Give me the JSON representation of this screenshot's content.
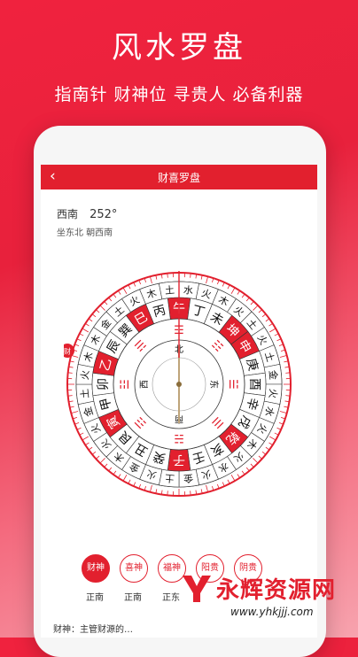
{
  "headline": "风水罗盘",
  "tagline": "指南针 财神位 寻贵人 必备利器",
  "appbar": {
    "back_label": "‹",
    "title": "财喜罗盘"
  },
  "direction": {
    "name": "西南",
    "degree": "252°",
    "detail": "坐东北 朝西南"
  },
  "compass": {
    "outer_ring_text": [
      "水",
      "火",
      "木",
      "火",
      "土",
      "火",
      "土",
      "金",
      "火",
      "水",
      "火",
      "木",
      "火",
      "水",
      "火",
      "金",
      "土",
      "火",
      "金",
      "木",
      "火",
      "火",
      "金",
      "土",
      "火",
      "木",
      "木",
      "金",
      "土",
      "火",
      "木",
      "土"
    ],
    "mountains": [
      "午",
      "丁",
      "未",
      "坤",
      "申",
      "庚",
      "酉",
      "辛",
      "戌",
      "乾",
      "亥",
      "壬",
      "子",
      "癸",
      "丑",
      "艮",
      "寅",
      "甲",
      "卯",
      "乙",
      "辰",
      "巽",
      "巳",
      "丙"
    ],
    "inner_labels": [
      "南",
      "西",
      "北",
      "东"
    ],
    "trigrams": [
      "☲",
      "☷",
      "☱",
      "☰",
      "☵",
      "☶",
      "☳",
      "☴"
    ],
    "side_mark": "财"
  },
  "markers": [
    {
      "label": "财神",
      "sub": "正南"
    },
    {
      "label": "喜神",
      "sub": "正南"
    },
    {
      "label": "福神",
      "sub": "正东"
    },
    {
      "label": "阳贵",
      "sub": ""
    },
    {
      "label": "阴贵",
      "sub": ""
    }
  ],
  "footer": "财神：主管财源的…",
  "watermark": {
    "brand": "永辉资源网",
    "url": "www.yhkjjj.com"
  },
  "colors": {
    "brand_red": "#e2202e",
    "bg_red": "#f0223e"
  }
}
